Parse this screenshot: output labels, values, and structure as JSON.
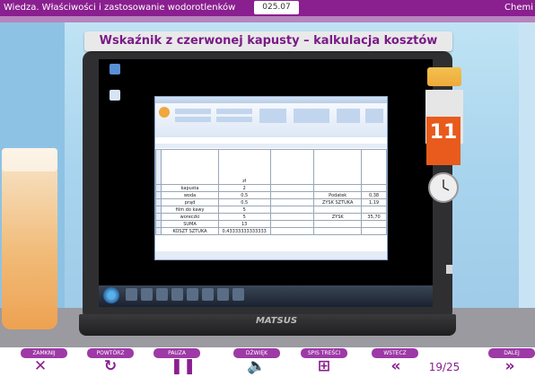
{
  "topbar": {
    "course_title": "Wiedza. Właściwości i zastosowanie wodorotlenków",
    "lesson_code": "025.07",
    "subject": "Chemi"
  },
  "title": "Wskaźnik z czerwonej kapusty – kalkulacja kosztów",
  "laptop": {
    "brand": "MATSUS"
  },
  "calendar_day": "11",
  "spreadsheet": {
    "header_unit": "zł",
    "rows": [
      {
        "label": "kapusta",
        "value": "2",
        "right_label": "",
        "right_value": ""
      },
      {
        "label": "woda",
        "value": "0,5",
        "right_label": "Podatek",
        "right_value": "0,38"
      },
      {
        "label": "prąd",
        "value": "0,5",
        "right_label": "ZYSK SZTUKA",
        "right_value": "1,19"
      },
      {
        "label": "film do kawy",
        "value": "5",
        "right_label": "",
        "right_value": ""
      },
      {
        "label": "woreczki",
        "value": "5",
        "right_label": "ZYSK",
        "right_value": "35,70"
      },
      {
        "label": "SUMA",
        "value": "13",
        "right_label": "",
        "right_value": ""
      },
      {
        "label": "KOSZT SZTUKA",
        "value": "0,43333333333333",
        "right_label": "",
        "right_value": ""
      }
    ]
  },
  "nav": {
    "close": "ZAMKNIJ",
    "repeat": "POWTÓRZ",
    "pause": "PAUZA",
    "sound": "DŹWIĘK",
    "toc": "SPIS TREŚCI",
    "back": "WSTECZ",
    "next": "DALEJ",
    "page": "19/25"
  },
  "icons": {
    "close": "close-icon",
    "repeat": "repeat-icon",
    "pause": "pause-icon",
    "sound": "speaker-icon",
    "toc": "sitemap-icon",
    "back": "double-chevron-left-icon",
    "next": "double-chevron-right-icon"
  },
  "colors": {
    "brand_purple": "#8a1f8f",
    "title_purple": "#7a1b86",
    "calendar_orange": "#e85b1d"
  }
}
